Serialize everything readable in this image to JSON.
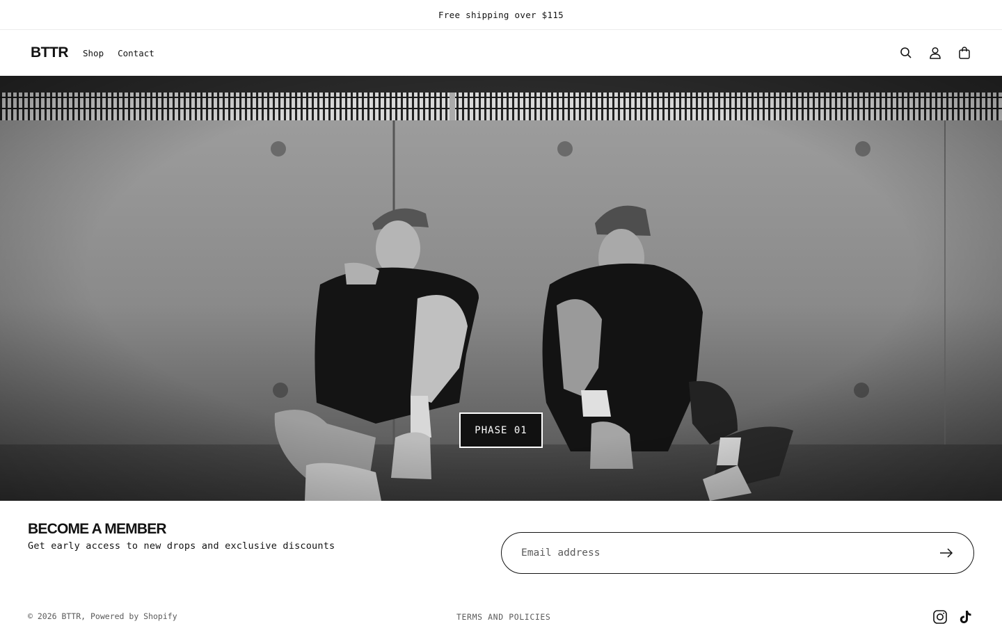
{
  "announcement": {
    "text": "Free shipping over $115"
  },
  "header": {
    "logo": "BTTR",
    "nav": [
      {
        "label": "Shop"
      },
      {
        "label": "Contact"
      }
    ],
    "icons": [
      "search-icon",
      "account-icon",
      "cart-icon"
    ]
  },
  "hero": {
    "button_label": "PHASE 01",
    "image": "black-and-white photo of two men in dark clothing and camo caps sitting against a concrete wall"
  },
  "newsletter": {
    "title": "BECOME A MEMBER",
    "subtitle": "Get early access to new drops and exclusive discounts",
    "placeholder": "Email address",
    "submit_icon": "arrow-right-icon"
  },
  "footer": {
    "copyright": "© 2026 BTTR, Powered by Shopify",
    "terms": "TERMS AND POLICIES",
    "social": [
      "instagram-icon",
      "tiktok-icon"
    ]
  },
  "colors": {
    "text": "#121212",
    "muted": "#5a5a5a",
    "background": "#ffffff",
    "hero_button_bg": "#111111"
  }
}
